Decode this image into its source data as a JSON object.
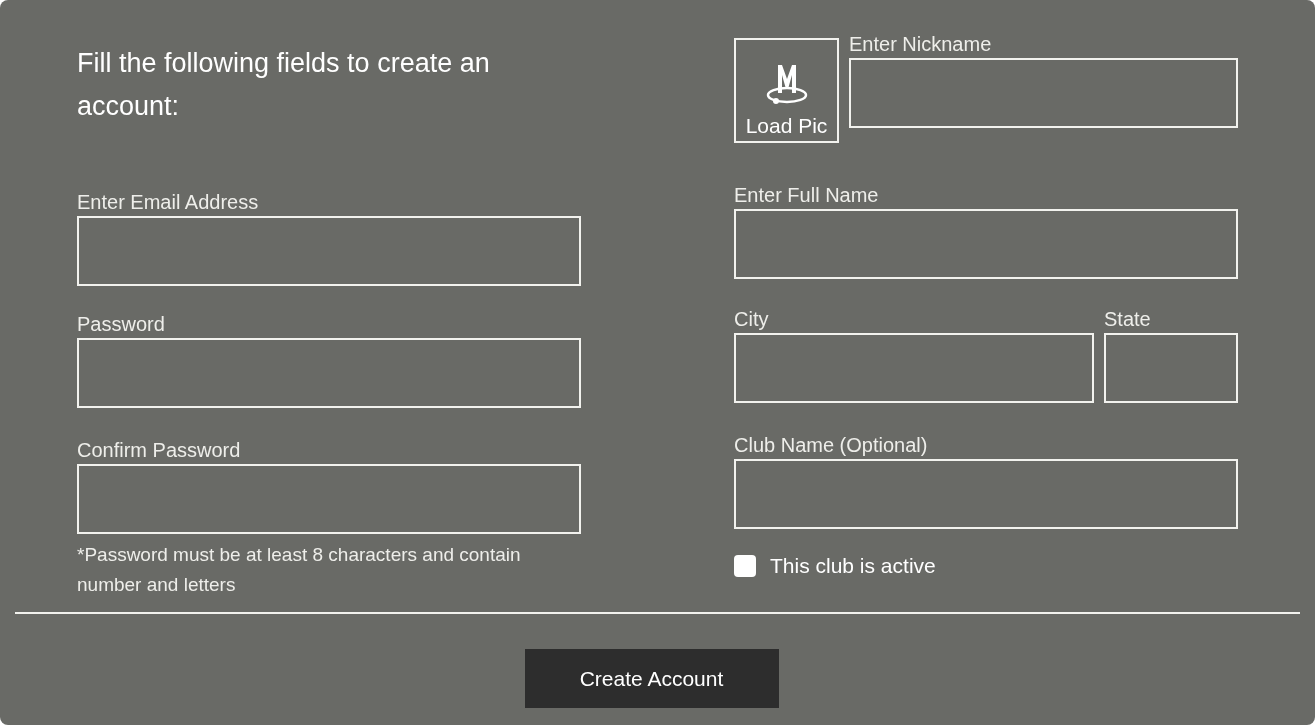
{
  "title": "Fill the following fields to create an account:",
  "load_pic": {
    "label": "Load Pic"
  },
  "nickname": {
    "label": "Enter Nickname"
  },
  "left_fields": [
    {
      "label": "Enter Email Address"
    },
    {
      "label": "Password"
    },
    {
      "label": "Confirm Password"
    }
  ],
  "password_note": "*Password must be at least 8 characters and contain number and letters",
  "full_name": {
    "label": "Enter Full Name"
  },
  "city": {
    "label": "City"
  },
  "state": {
    "label": "State"
  },
  "club_name": {
    "label": "Club Name (Optional)"
  },
  "club_active": {
    "label": "This club is active",
    "checked": false
  },
  "submit": {
    "label": "Create Account"
  }
}
